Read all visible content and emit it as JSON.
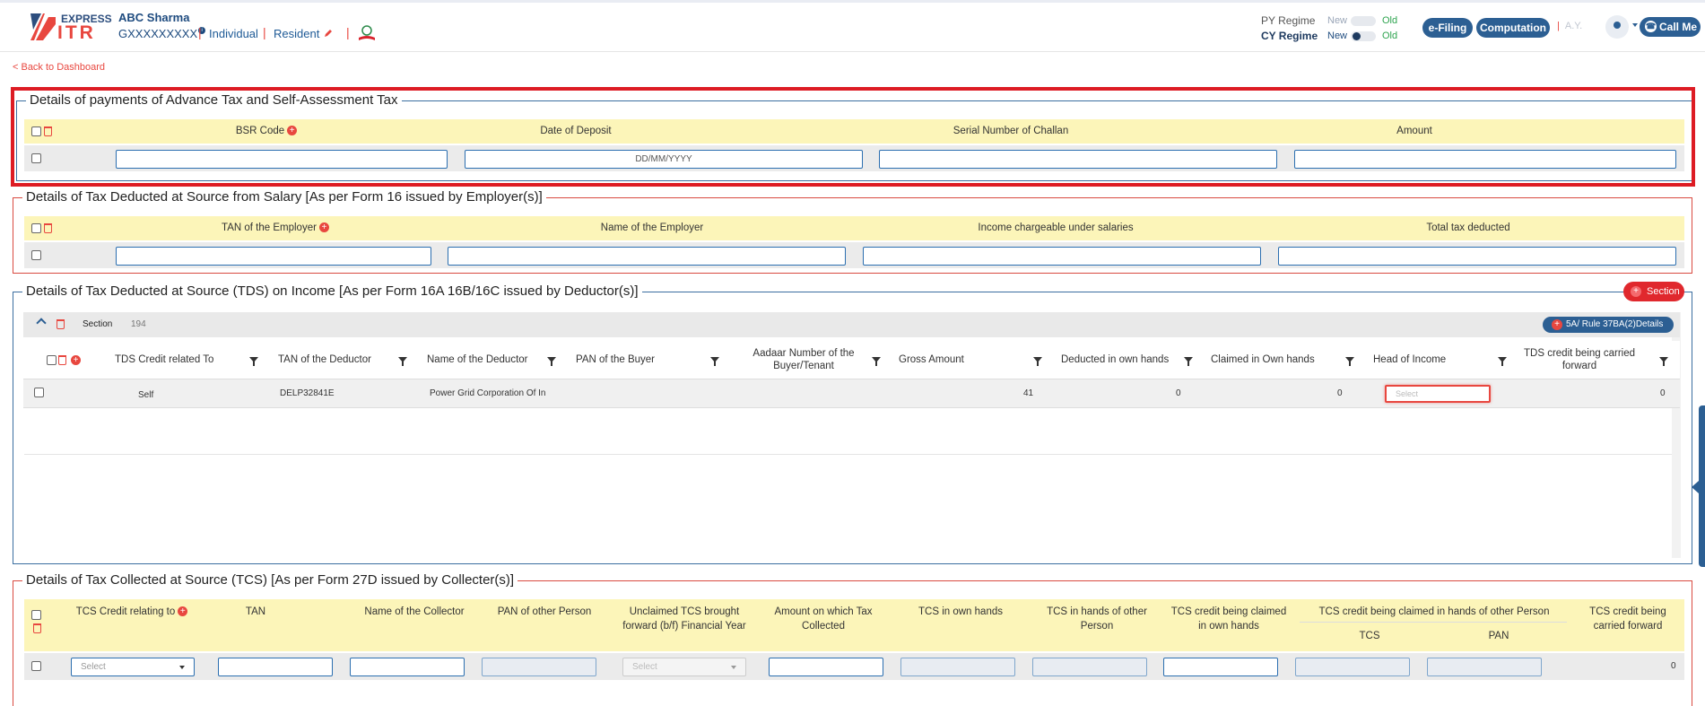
{
  "header": {
    "brand_top": "EXPRESS",
    "brand_bottom": "ITR",
    "user_name": "ABC Sharma",
    "user_pan": "GXXXXXXXXX",
    "status": "Individual",
    "residency": "Resident",
    "py_regime_label": "PY Regime",
    "cy_regime_label": "CY Regime",
    "new_label": "New",
    "old_label": "Old",
    "efiling": "e-Filing",
    "computation": "Computation",
    "ay_label": "A.Y.",
    "call_me": "Call Me"
  },
  "back_link": "< Back to Dashboard",
  "advance_tax": {
    "title": "Details of payments of Advance Tax and Self-Assessment Tax",
    "columns": [
      "BSR Code",
      "Date of Deposit",
      "Serial Number of Challan",
      "Amount"
    ],
    "date_placeholder": "DD/MM/YYYY"
  },
  "tds_salary": {
    "title": "Details of Tax Deducted at Source from Salary [As per Form 16 issued by Employer(s)]",
    "columns": [
      "TAN of the Employer",
      "Name of the Employer",
      "Income chargeable under salaries",
      "Total tax deducted"
    ]
  },
  "tds_income": {
    "title": "Details of Tax Deducted at Source (TDS) on Income [As per Form 16A 16B/16C issued by Deductor(s)]",
    "section_button": "Section",
    "section_label": "Section",
    "section_value": "194",
    "rule_button": "5A/ Rule 37BA(2)Details",
    "columns": [
      "TDS Credit related To",
      "TAN of the Deductor",
      "Name of the Deductor",
      "PAN of the Buyer",
      "Aadaar Number of the Buyer/Tenant",
      "Gross Amount",
      "Deducted in own hands",
      "Claimed in Own hands",
      "Head of Income",
      "TDS credit being carried forward"
    ],
    "row": {
      "credit_to": "Self",
      "tan": "DELP32841E",
      "name": "Power Grid Corporation Of In",
      "gross": "41",
      "deducted": "0",
      "claimed": "0",
      "head_placeholder": "Select",
      "carried": "0"
    }
  },
  "tcs": {
    "title": "Details of Tax Collected at Source (TCS) [As per Form 27D issued by Collecter(s)]",
    "columns": {
      "credit_relating": "TCS Credit relating to",
      "tan": "TAN",
      "collector": "Name of the Collector",
      "pan_other": "PAN of other Person",
      "unclaimed": "Unclaimed TCS brought forward (b/f) Financial Year",
      "amount": "Amount on which Tax Collected",
      "own_hands": "TCS in own hands",
      "other_hands": "TCS in hands of other Person",
      "claimed_own": "TCS credit being claimed in own hands",
      "claimed_other": "TCS credit being claimed in hands of other Person",
      "sub_tcs": "TCS",
      "sub_pan": "PAN",
      "carried": "TCS credit being carried forward"
    },
    "row": {
      "select": "Select",
      "select_disabled": "Select",
      "carried": "0"
    }
  },
  "colors": {
    "brand_blue": "#2c5f93",
    "brand_red": "#e8473f",
    "highlight_red": "#dd1c24",
    "header_yellow": "#fcf5b9"
  }
}
